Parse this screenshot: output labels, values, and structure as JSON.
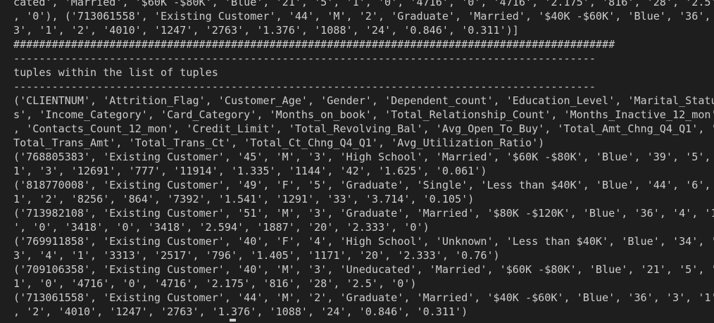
{
  "terminal": {
    "lines": [
      "cated', 'Married', '$60K -$80K', 'Blue', '21', '5', '1', '0', '4716', '0', '4716', '2.175', '816', '28', '2.5'",
      ", '0'), ('713061558', 'Existing Customer', '44', 'M', '2', 'Graduate', 'Married', '$40K -$60K', 'Blue', '36', '",
      "3', '1', '2', '4010', '1247', '2763', '1.376', '1088', '24', '0.846', '0.311')]",
      "##############################################################################################",
      "-------------------------------------------------------------------------------------------",
      "tuples within the list of tuples",
      "-------------------------------------------------------------------------------------------",
      "('CLIENTNUM', 'Attrition_Flag', 'Customer_Age', 'Gender', 'Dependent_count', 'Education_Level', 'Marital_Statu",
      "s', 'Income_Category', 'Card_Category', 'Months_on_book', 'Total_Relationship_Count', 'Months_Inactive_12_mon'",
      ", 'Contacts_Count_12_mon', 'Credit_Limit', 'Total_Revolving_Bal', 'Avg_Open_To_Buy', 'Total_Amt_Chng_Q4_Q1', '",
      "Total_Trans_Amt', 'Total_Trans_Ct', 'Total_Ct_Chng_Q4_Q1', 'Avg_Utilization_Ratio')",
      "('768805383', 'Existing Customer', '45', 'M', '3', 'High School', 'Married', '$60K -$80K', 'Blue', '39', '5', '",
      "1', '3', '12691', '777', '11914', '1.335', '1144', '42', '1.625', '0.061')",
      "('818770008', 'Existing Customer', '49', 'F', '5', 'Graduate', 'Single', 'Less than $40K', 'Blue', '44', '6', '",
      "1', '2', '8256', '864', '7392', '1.541', '1291', '33', '3.714', '0.105')",
      "('713982108', 'Existing Customer', '51', 'M', '3', 'Graduate', 'Married', '$80K -$120K', 'Blue', '36', '4', '1",
      "', '0', '3418', '0', '3418', '2.594', '1887', '20', '2.333', '0')",
      "('769911858', 'Existing Customer', '40', 'F', '4', 'High School', 'Unknown', 'Less than $40K', 'Blue', '34', '",
      "3', '4', '1', '3313', '2517', '796', '1.405', '1171', '20', '2.333', '0.76')",
      "('709106358', 'Existing Customer', '40', 'M', '3', 'Uneducated', 'Married', '$60K -$80K', 'Blue', '21', '5', '",
      "1', '0', '4716', '0', '4716', '2.175', '816', '28', '2.5', '0')",
      "('713061558', 'Existing Customer', '44', 'M', '2', 'Graduate', 'Married', '$40K -$60K', 'Blue', '36', '3', '1'",
      ", '2', '4010', '1247', '2763', '1.376', '1088', '24', '0.846', '0.311')"
    ]
  },
  "colors": {
    "background": "#1e1e1e",
    "foreground": "#cccccc"
  }
}
